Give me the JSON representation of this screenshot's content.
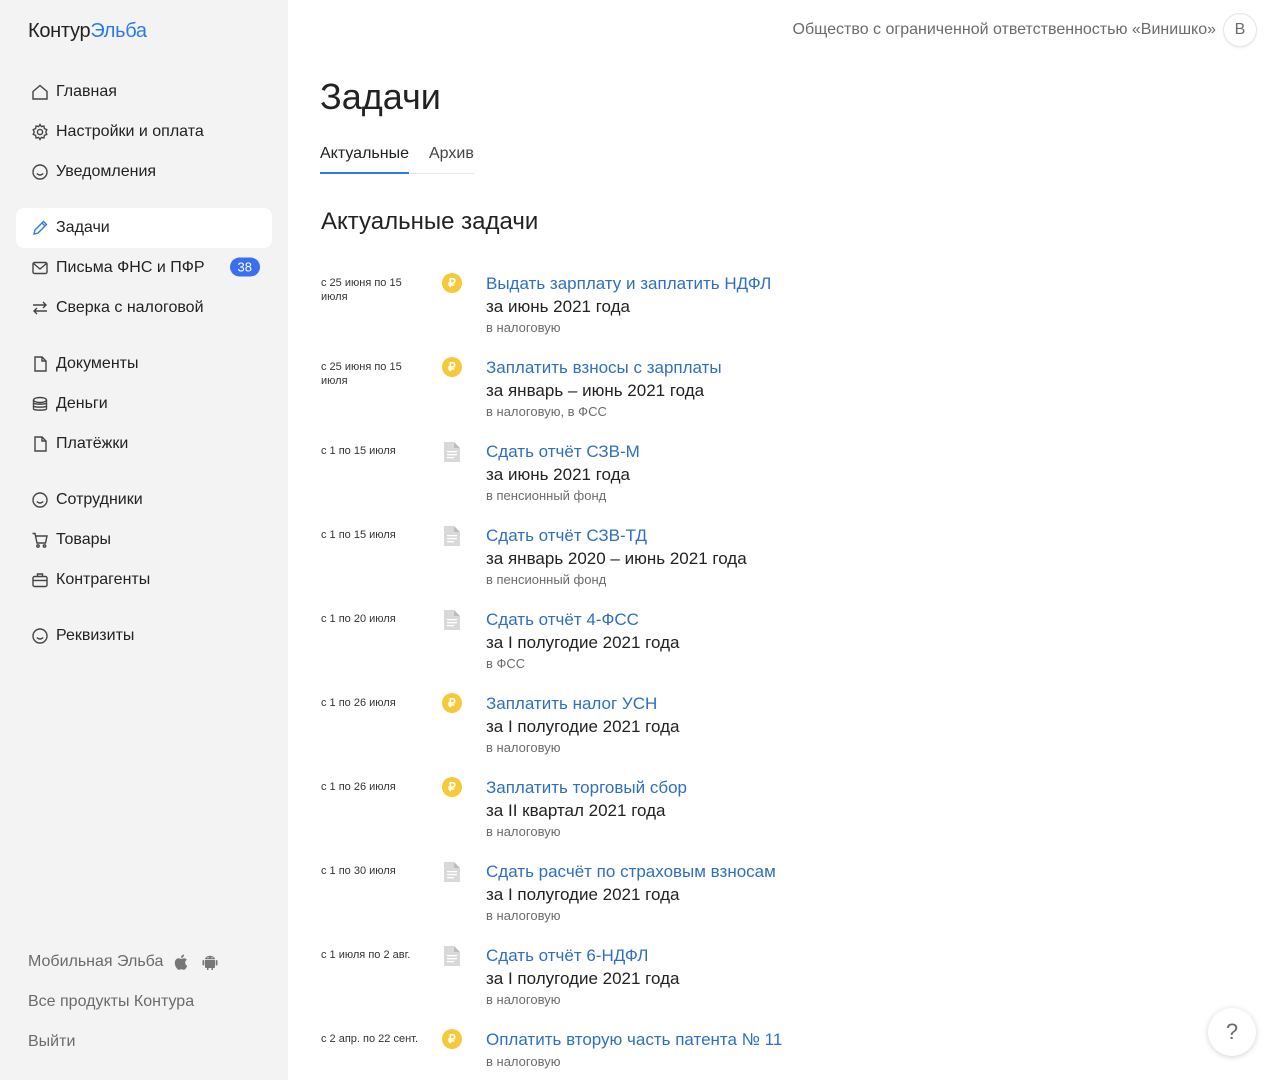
{
  "logo": {
    "part1": "Контур",
    "part2": "Эльба"
  },
  "header": {
    "org": "Общество с ограниченной ответственностью «Винишко»",
    "avatar_letter": "В"
  },
  "sidebar": {
    "items": [
      {
        "label": "Главная",
        "icon": "home-icon"
      },
      {
        "label": "Настройки и оплата",
        "icon": "gear-icon"
      },
      {
        "label": "Уведомления",
        "icon": "smiley-icon"
      },
      {
        "label": "Задачи",
        "icon": "pencil-icon",
        "active": true
      },
      {
        "label": "Письма ФНС и ПФР",
        "icon": "mail-icon",
        "badge": "38"
      },
      {
        "label": "Сверка с налоговой",
        "icon": "swap-icon"
      },
      {
        "label": "Документы",
        "icon": "document-icon"
      },
      {
        "label": "Деньги",
        "icon": "coins-stack-icon"
      },
      {
        "label": "Платёжки",
        "icon": "document-icon"
      },
      {
        "label": "Сотрудники",
        "icon": "smiley-icon"
      },
      {
        "label": "Товары",
        "icon": "cart-icon"
      },
      {
        "label": "Контрагенты",
        "icon": "briefcase-icon"
      },
      {
        "label": "Реквизиты",
        "icon": "smiley-icon"
      }
    ],
    "footer": {
      "mobile": "Мобильная Эльба",
      "products": "Все продукты Контура",
      "logout": "Выйти"
    }
  },
  "main": {
    "title": "Задачи",
    "tabs": [
      {
        "label": "Актуальные",
        "active": true
      },
      {
        "label": "Архив",
        "active": false
      }
    ],
    "section_title": "Актуальные задачи",
    "tasks": [
      {
        "date": "с 25 июня по 15 июля",
        "icon": "ruble-coin-icon",
        "title": "Выдать зарплату и заплатить НДФЛ",
        "period": "за июнь 2021 года",
        "dest": "в налоговую"
      },
      {
        "date": "с 25 июня по 15 июля",
        "icon": "ruble-coin-icon",
        "title": "Заплатить взносы с зарплаты",
        "period": "за январь – июнь 2021 года",
        "dest": "в налоговую, в ФСС"
      },
      {
        "date": "с 1 по 15 июля",
        "icon": "report-document-icon",
        "title": "Сдать отчёт СЗВ-М",
        "period": "за июнь 2021 года",
        "dest": "в пенсионный фонд"
      },
      {
        "date": "с 1 по 15 июля",
        "icon": "report-document-icon",
        "title": "Сдать отчёт СЗВ-ТД",
        "period": "за январь 2020 – июнь 2021 года",
        "dest": "в пенсионный фонд"
      },
      {
        "date": "с 1 по 20 июля",
        "icon": "report-document-icon",
        "title": "Сдать отчёт 4-ФСС",
        "period": "за I полугодие 2021 года",
        "dest": "в ФСС"
      },
      {
        "date": "с 1 по 26 июля",
        "icon": "ruble-coin-icon",
        "title": "Заплатить налог УСН",
        "period": "за I полугодие 2021 года",
        "dest": "в налоговую"
      },
      {
        "date": "с 1 по 26 июля",
        "icon": "ruble-coin-icon",
        "title": "Заплатить торговый сбор",
        "period": "за II квартал 2021 года",
        "dest": "в налоговую"
      },
      {
        "date": "с 1 по 30 июля",
        "icon": "report-document-icon",
        "title": "Сдать расчёт по страховым взносам",
        "period": "за I полугодие 2021 года",
        "dest": "в налоговую"
      },
      {
        "date": "с 1 июля по 2 авг.",
        "icon": "report-document-icon",
        "title": "Сдать отчёт 6-НДФЛ",
        "period": "за I полугодие 2021 года",
        "dest": "в налоговую"
      },
      {
        "date": "с 2 апр. по 22 сент.",
        "icon": "ruble-coin-icon",
        "title": "Оплатить вторую часть патента № 11",
        "period": "",
        "dest": "в налоговую"
      }
    ]
  },
  "help": {
    "label": "?"
  },
  "colors": {
    "accent": "#2f7be6",
    "link": "#2f6fbf",
    "badge": "#3a6ff0",
    "coin": "#f6c93a"
  }
}
